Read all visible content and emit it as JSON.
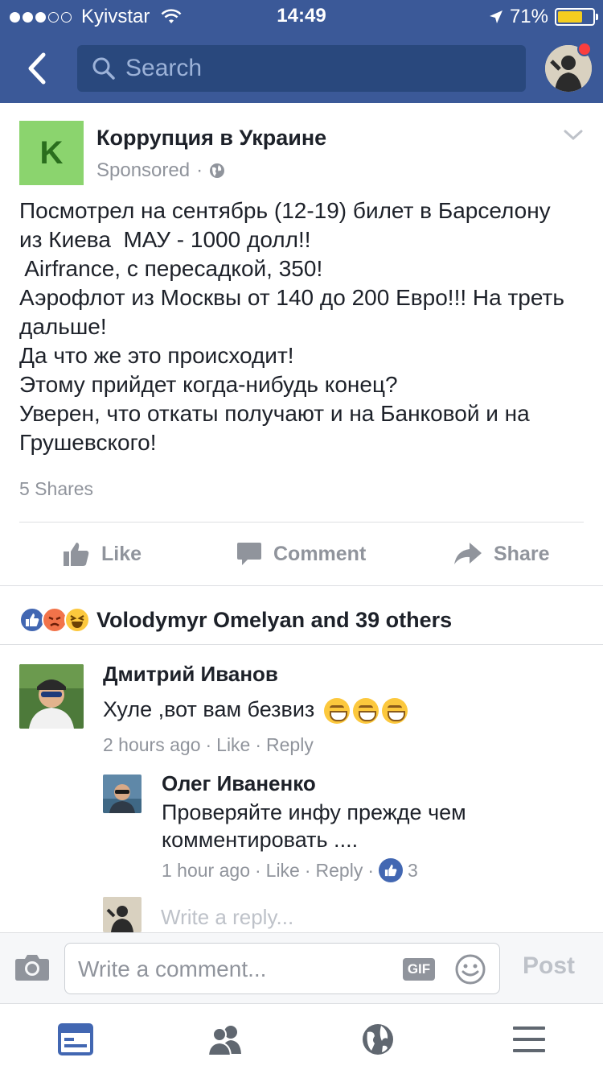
{
  "status_bar": {
    "carrier": "Kyivstar",
    "time": "14:49",
    "battery": "71%",
    "battery_level": 0.71
  },
  "header": {
    "search_placeholder": "Search"
  },
  "post": {
    "page_logo_letter": "K",
    "page_name": "Коррупция в Украине",
    "sponsored_label": "Sponsored",
    "text_lines": [
      "Посмотрел на сентябрь (12-19) билет в Барселону",
      "из Киева  МАУ - 1000 долл!!",
      " Airfrance, с пересадкой, 350!",
      "Аэрофлот из Москвы от 140 до 200 Евро!!! На треть",
      "дальше!",
      "Да что же это происходит!",
      "Этому прийдет когда-нибудь конец?",
      "Уверен, что откаты получают и на Банковой и на",
      "Грушевского!"
    ],
    "shares": "5 Shares",
    "actions": {
      "like": "Like",
      "comment": "Comment",
      "share": "Share"
    },
    "reactions_text": "Volodymyr Omelyan and 39 others"
  },
  "comments": [
    {
      "author": "Дмитрий Иванов",
      "text": "Хуле ,вот вам безвиз",
      "time": "2 hours ago",
      "like": "Like",
      "reply": "Reply",
      "sep": "·"
    },
    {
      "author": "Олег Иваненко",
      "text_line1": "Проверяйте инфу прежде чем",
      "text_line2": "комментировать ....",
      "time": "1 hour ago",
      "like": "Like",
      "reply": "Reply",
      "sep": "·",
      "like_count": "3"
    }
  ],
  "reply_placeholder": "Write a reply...",
  "composer": {
    "placeholder": "Write a comment...",
    "gif_label": "GIF",
    "post_label": "Post"
  },
  "colors": {
    "brand_blue": "#3b5998",
    "search_bg": "#29487d",
    "page_logo_bg": "#8bd46e",
    "meta_gray": "#90949c",
    "notification_red": "#fa3e3e"
  },
  "icons": {
    "back": "chevron-left-icon",
    "search": "search-icon",
    "globe": "globe-icon",
    "like": "thumbs-up-icon",
    "comment": "comment-bubble-icon",
    "share": "share-arrow-icon",
    "camera": "camera-icon",
    "smile": "smiley-icon",
    "tabs": [
      "news-feed-icon",
      "friends-icon",
      "globe-icon",
      "menu-icon"
    ]
  }
}
